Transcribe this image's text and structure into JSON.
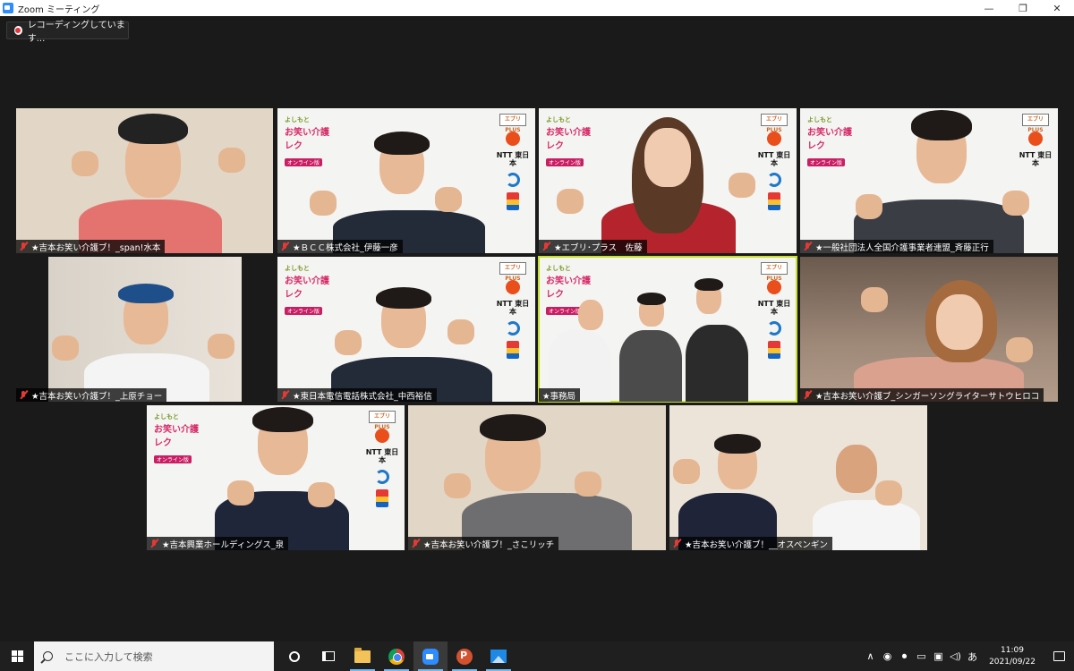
{
  "window": {
    "title": "Zoom ミーティング",
    "minimize": "—",
    "maximize": "❐",
    "close": "✕"
  },
  "recording": {
    "text": "レコーディングしています..."
  },
  "participants": [
    {
      "name": "★吉本お笑い介護ブ！_span!水本"
    },
    {
      "name": "★ＢＣＣ株式会社_伊藤一彦"
    },
    {
      "name": "★エブリ･プラス　佐藤"
    },
    {
      "name": "★一般社団法人全国介護事業者連盟_斉藤正行"
    },
    {
      "name": "★吉本お笑い介護ブ！_上原チョー"
    },
    {
      "name": "★東日本電信電話株式会社_中西裕信"
    },
    {
      "name": "★事務局"
    },
    {
      "name": "★吉本お笑い介護ブ_シンガーソングライターサトウヒロコ"
    },
    {
      "name": "★吉本興業ホールディングス_泉"
    },
    {
      "name": "★吉本お笑い介護ブ！_さこリッチ"
    },
    {
      "name": "★吉本お笑い介護ブ！__オスペンギン"
    }
  ],
  "background_logos": {
    "show_small": "よしもと",
    "show_title": "お笑い介護レク",
    "show_tag": "オンライン版",
    "partner1": "エブリPLUS",
    "partner2": "NTT 東日本"
  },
  "taskbar": {
    "search_placeholder": "ここに入力して検索",
    "ime": "あ",
    "time": "11:09",
    "date": "2021/09/22"
  },
  "colors": {
    "active_speaker": "#c6df29",
    "muted": "#e53935",
    "zoom_blue": "#2d8cff"
  }
}
